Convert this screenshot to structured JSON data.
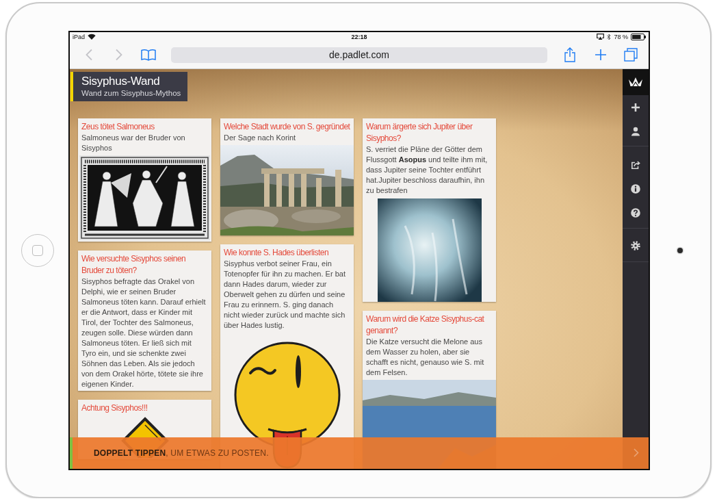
{
  "status_bar": {
    "device": "iPad",
    "time": "22:18",
    "battery": "78 %"
  },
  "browser": {
    "back": {
      "disabled": true
    },
    "forward": {
      "disabled": true
    },
    "url": "de.padlet.com"
  },
  "wall": {
    "title": "Sisyphus-Wand",
    "subtitle": "Wand zum Sisyphus-Mythos"
  },
  "columns": [
    {
      "cards": [
        {
          "kind": "vase",
          "title": "Zeus tötet Salmoneus",
          "body": "Salmoneus war der Bruder von Sisyphos"
        },
        {
          "kind": "text",
          "title": "Wie versuchte Sisyphos seinen Bruder zu töten?",
          "body": "Sisyphos befragte das Orakel von Delphi, wie er seinen Bruder Salmoneus töten kann. Darauf erhielt er die Antwort, dass er Kinder mit Tirol, der Tochter des Salmoneus, zeugen solle. Diese würden dann Salmoneus töten. Er ließ sich mit Tyro ein, und sie schenkte zwei Söhnen das Leben. Als sie jedoch von dem Orakel hörte, tötete sie ihre eigenen Kinder."
        },
        {
          "kind": "sign",
          "title": "Achtung Sisyphos!!!"
        }
      ]
    },
    {
      "cards": [
        {
          "kind": "ruins",
          "title": "Welche Stadt wurde von S. gegründet",
          "body": "Der Sage nach Korint"
        },
        {
          "kind": "smiley",
          "title": "Wie konnte S. Hades überlisten",
          "body": "Sisyphus verbot seiner Frau, ein Totenopfer für ihn zu machen. Er bat dann Hades darum, wieder zur Oberwelt gehen zu dürfen und seine Frau zu erinnern. S. ging danach nicht wieder zurück und machte sich über Hades lustig."
        }
      ]
    },
    {
      "cards": [
        {
          "kind": "painting",
          "title": "Warum ärgerte sich Jupiter über Sisyphos?",
          "body": "S. verriet die Pläne der Götter dem Flussgott **Asopus** und teilte ihm mit, dass Jupiter seine Tochter entführt hat.Jupiter beschloss daraufhin, ihn zu bestrafen"
        },
        {
          "kind": "seascape",
          "title": "Warum wird die Katze Sisyphus-cat genannt?",
          "body": "Die Katze versucht die Melone aus dem Wasser zu holen, aber sie schafft es nicht, genauso wie S. mit dem Felsen."
        }
      ]
    }
  ],
  "post_bar": {
    "text": "**DOPPELT TIPPEN**, UM ETWAS ZU POSTEN."
  }
}
